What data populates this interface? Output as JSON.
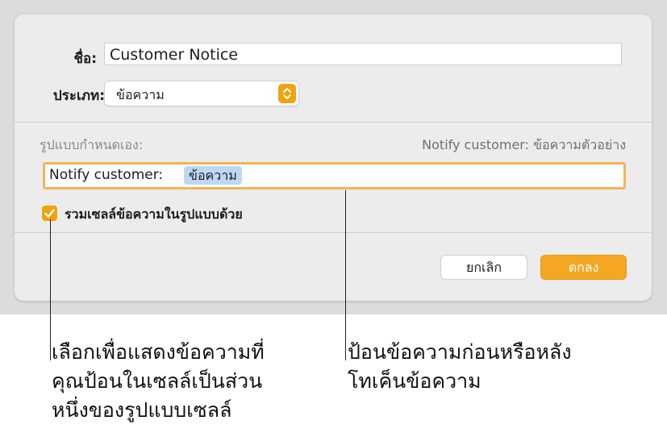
{
  "dialog": {
    "name_label": "ชื่อ:",
    "name_value": "Customer Notice",
    "type_label": "ประเภท:",
    "type_value": "ข้อความ",
    "custom_format_label": "รูปแบบกำหนดเอง:",
    "preview": "Notify customer: ข้อความตัวอย่าง",
    "format_prefix": "Notify customer:",
    "format_token": "ข้อความ",
    "checkbox_label": "รวมเซลล์ข้อความในรูปแบบด้วย",
    "checkbox_checked": true,
    "cancel_label": "ยกเลิก",
    "ok_label": "ตกลง"
  },
  "callouts": {
    "left": [
      "เลือกเพื่อแสดงข้อความที่",
      "คุณป้อนในเซลล์เป็นส่วน",
      "หนึ่งของรูปแบบเซลล์"
    ],
    "right": [
      "ป้อนข้อความก่อนหรือหลัง",
      "โทเค็นข้อความ"
    ]
  },
  "colors": {
    "accent": "#f5a623",
    "token": "#bcd8f5",
    "focus_ring": "#f5b454"
  },
  "icons": {
    "stepper": "chevron-up-down-icon",
    "checkbox": "checkmark-icon"
  }
}
